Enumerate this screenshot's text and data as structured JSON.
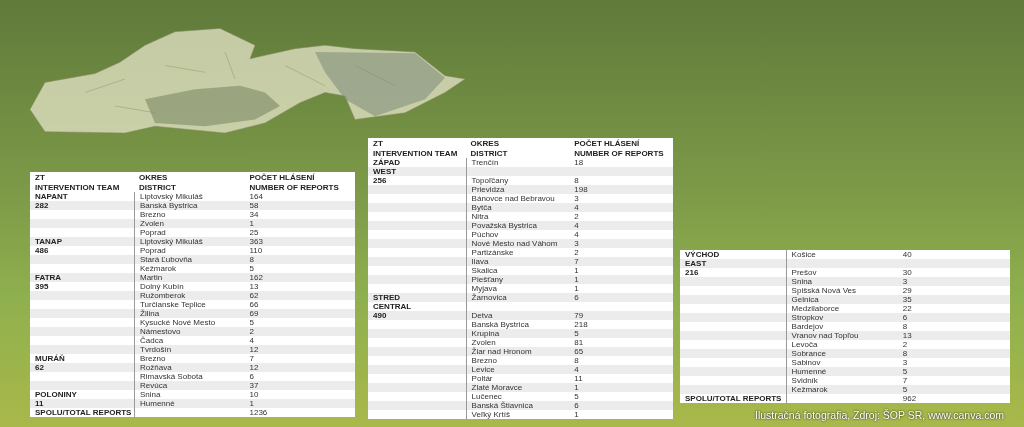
{
  "tables": [
    {
      "header_rows": [
        [
          "ZT",
          "OKRES",
          "POČET HLÁSENÍ"
        ],
        [
          "INTERVENTION TEAM",
          "DISTRICT",
          "NUMBER OF REPORTS"
        ]
      ],
      "rows": [
        {
          "team": "NAPANT",
          "district": "Liptovský Mikuláš",
          "reports": "164"
        },
        {
          "team": "282",
          "district": "Banská Bystrica",
          "reports": "58"
        },
        {
          "district": "Brezno",
          "reports": "34"
        },
        {
          "district": "Zvolen",
          "reports": "1"
        },
        {
          "district": "Poprad",
          "reports": "25"
        },
        {
          "team": "TANAP",
          "district": "Liptovský Mikuláš",
          "reports": "363"
        },
        {
          "team": "486",
          "district": "Poprad",
          "reports": "110"
        },
        {
          "district": "Stará Ľubovňa",
          "reports": "8"
        },
        {
          "district": "Kežmarok",
          "reports": "5"
        },
        {
          "team": "FATRA",
          "district": "Martin",
          "reports": "162"
        },
        {
          "team": "395",
          "district": "Dolný Kubín",
          "reports": "13"
        },
        {
          "district": "Ružomberok",
          "reports": "62"
        },
        {
          "district": "Turčianske Teplice",
          "reports": "66"
        },
        {
          "district": "Žilina",
          "reports": "69"
        },
        {
          "district": "Kysucké Nové Mesto",
          "reports": "5"
        },
        {
          "district": "Námestovo",
          "reports": "2"
        },
        {
          "district": "Čadca",
          "reports": "4"
        },
        {
          "district": "Tvrdošín",
          "reports": "12"
        },
        {
          "team": "MURÁŇ",
          "district": "Brezno",
          "reports": "7"
        },
        {
          "team": "62",
          "district": "Rožňava",
          "reports": "12"
        },
        {
          "district": "Rimavská Sobota",
          "reports": "6"
        },
        {
          "district": "Revúca",
          "reports": "37"
        },
        {
          "team": "POLONINY",
          "district": "Snina",
          "reports": "10"
        },
        {
          "team": "11",
          "district": "Humenné",
          "reports": "1"
        },
        {
          "team": "SPOLU/TOTAL REPORTS",
          "reports": "1236"
        }
      ]
    },
    {
      "header_rows": [
        [
          "ZT",
          "OKRES",
          "POČET HLÁSENÍ"
        ],
        [
          "INTERVENTION TEAM",
          "DISTRICT",
          "NUMBER OF REPORTS"
        ]
      ],
      "rows": [
        {
          "team": "ZÁPAD",
          "district": "Trenčín",
          "reports": "18"
        },
        {
          "team": "WEST"
        },
        {
          "team": "256",
          "district": "Topoľčany",
          "reports": "8"
        },
        {
          "district": "Prievidza",
          "reports": "198"
        },
        {
          "district": "Bánovce nad Bebravou",
          "reports": "3"
        },
        {
          "district": "Bytča",
          "reports": "4"
        },
        {
          "district": "Nitra",
          "reports": "2"
        },
        {
          "district": "Považská Bystrica",
          "reports": "4"
        },
        {
          "district": "Púchov",
          "reports": "4"
        },
        {
          "district": "Nové Mesto nad Váhom",
          "reports": "3"
        },
        {
          "district": "Partizánske",
          "reports": "2"
        },
        {
          "district": "Ilava",
          "reports": "7"
        },
        {
          "district": "Skalica",
          "reports": "1"
        },
        {
          "district": "Piešťany",
          "reports": "1"
        },
        {
          "district": "Myjava",
          "reports": "1"
        },
        {
          "team": "STRED",
          "district": "Žarnovica",
          "reports": "6"
        },
        {
          "team": "CENTRAL"
        },
        {
          "team": "490",
          "district": "Detva",
          "reports": "79"
        },
        {
          "district": "Banská Bystrica",
          "reports": "218"
        },
        {
          "district": "Krupina",
          "reports": "5"
        },
        {
          "district": "Zvolen",
          "reports": "81"
        },
        {
          "district": "Žiar nad Hronom",
          "reports": "65"
        },
        {
          "district": "Brezno",
          "reports": "8"
        },
        {
          "district": "Levice",
          "reports": "4"
        },
        {
          "district": "Poltár",
          "reports": "11"
        },
        {
          "district": "Zlaté Moravce",
          "reports": "1"
        },
        {
          "district": "Lučenec",
          "reports": "5"
        },
        {
          "district": "Banská Štiavnica",
          "reports": "6"
        },
        {
          "district": "Veľký Krtíš",
          "reports": "1"
        }
      ]
    },
    {
      "rows": [
        {
          "team": "VÝCHOD",
          "district": "Košice",
          "reports": "40"
        },
        {
          "team": "EAST"
        },
        {
          "team": "216",
          "district": "Prešov",
          "reports": "30"
        },
        {
          "district": "Snina",
          "reports": "3"
        },
        {
          "district": "Spišská Nová Ves",
          "reports": "29"
        },
        {
          "district": "Gelnica",
          "reports": "35"
        },
        {
          "district": "Medzilaborce",
          "reports": "22"
        },
        {
          "district": "Stropkov",
          "reports": "6"
        },
        {
          "district": "Bardejov",
          "reports": "8"
        },
        {
          "district": "Vranov nad Topľou",
          "reports": "13"
        },
        {
          "district": "Levoča",
          "reports": "2"
        },
        {
          "district": "Sobrance",
          "reports": "8"
        },
        {
          "district": "Sabinov",
          "reports": "3"
        },
        {
          "district": "Humenné",
          "reports": "5"
        },
        {
          "district": "Svidník",
          "reports": "7"
        },
        {
          "district": "Kežmarok",
          "reports": "5"
        },
        {
          "team": "SPOLU/TOTAL REPORTS",
          "reports": "962"
        }
      ]
    }
  ],
  "caption": "Ilustračná fotografia, Zdroj: ŠOP SR, www.canva.com"
}
